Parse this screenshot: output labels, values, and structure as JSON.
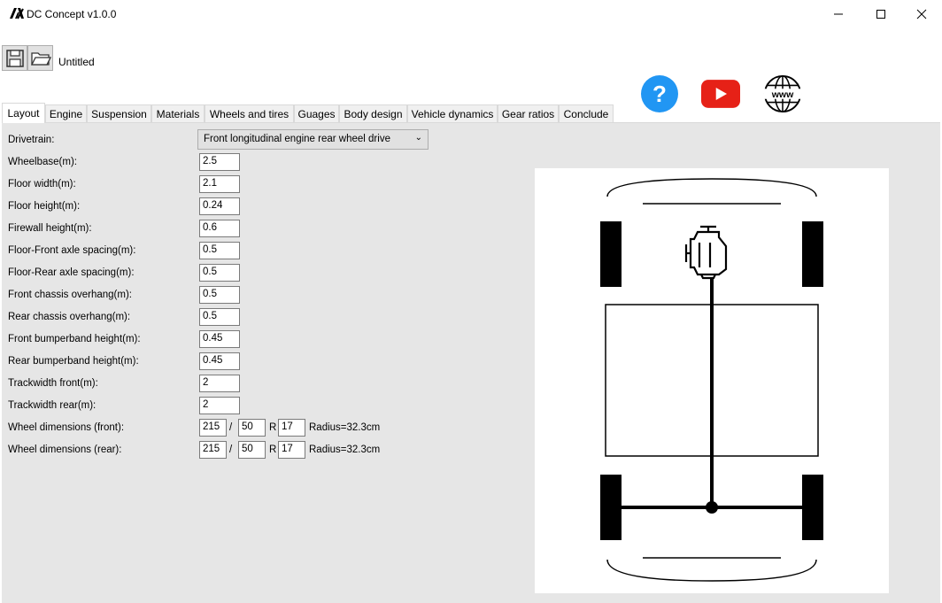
{
  "window": {
    "title": "DC Concept v1.0.0"
  },
  "toolbar": {
    "document_name": "Untitled"
  },
  "tabs": [
    {
      "label": "Layout"
    },
    {
      "label": "Engine"
    },
    {
      "label": "Suspension"
    },
    {
      "label": "Materials"
    },
    {
      "label": "Wheels and tires"
    },
    {
      "label": "Guages"
    },
    {
      "label": "Body design"
    },
    {
      "label": "Vehicle dynamics"
    },
    {
      "label": "Gear ratios"
    },
    {
      "label": "Conclude"
    }
  ],
  "layout": {
    "drivetrain_label": "Drivetrain:",
    "drivetrain_value": "Front longitudinal engine rear wheel drive",
    "fields": [
      {
        "label": "Wheelbase(m):",
        "value": "2.5"
      },
      {
        "label": "Floor width(m):",
        "value": "2.1"
      },
      {
        "label": "Floor height(m):",
        "value": "0.24"
      },
      {
        "label": "Firewall height(m):",
        "value": "0.6"
      },
      {
        "label": "Floor-Front axle spacing(m):",
        "value": "0.5"
      },
      {
        "label": "Floor-Rear axle spacing(m):",
        "value": "0.5"
      },
      {
        "label": "Front chassis overhang(m):",
        "value": "0.5"
      },
      {
        "label": "Rear chassis overhang(m):",
        "value": "0.5"
      },
      {
        "label": "Front bumperband height(m):",
        "value": "0.45"
      },
      {
        "label": "Rear bumperband height(m):",
        "value": "0.45"
      },
      {
        "label": "Trackwidth front(m):",
        "value": "2"
      },
      {
        "label": "Trackwidth rear(m):",
        "value": "2"
      }
    ],
    "wheel_front": {
      "label": "Wheel dimensions (front):",
      "width": "215",
      "sep": "/",
      "aspect": "50",
      "r": "R",
      "rim": "17",
      "radius": "Radius=32.3cm"
    },
    "wheel_rear": {
      "label": "Wheel dimensions (rear):",
      "width": "215",
      "sep": "/",
      "aspect": "50",
      "r": "R",
      "rim": "17",
      "radius": "Radius=32.3cm"
    }
  },
  "colors": {
    "help": "#2196f3",
    "youtube": "#e62117",
    "panel": "#e6e6e6"
  }
}
